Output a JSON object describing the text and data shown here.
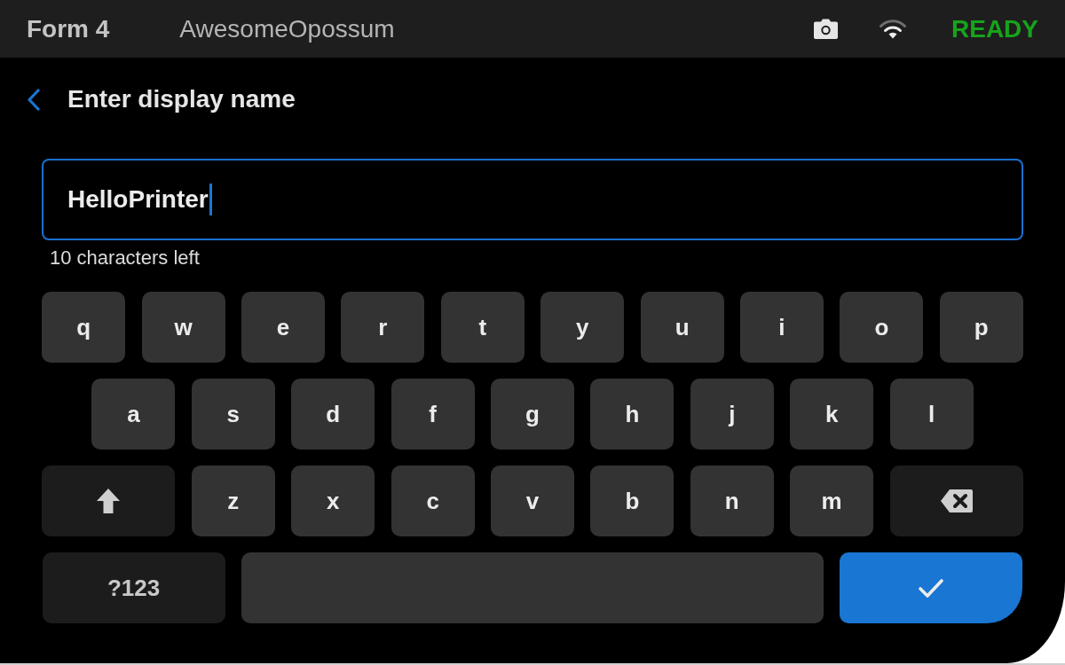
{
  "status_bar": {
    "model": "Form 4",
    "printer_name": "AwesomeOpossum",
    "status": "READY"
  },
  "header": {
    "title": "Enter display name"
  },
  "name_field": {
    "value": "HelloPrinter",
    "focused": true
  },
  "helper_text": "10 characters left",
  "keyboard": {
    "rows": [
      [
        {
          "kind": "letter",
          "label": "q"
        },
        {
          "kind": "letter",
          "label": "w"
        },
        {
          "kind": "letter",
          "label": "e"
        },
        {
          "kind": "letter",
          "label": "r"
        },
        {
          "kind": "letter",
          "label": "t"
        },
        {
          "kind": "letter",
          "label": "y"
        },
        {
          "kind": "letter",
          "label": "u"
        },
        {
          "kind": "letter",
          "label": "i"
        },
        {
          "kind": "letter",
          "label": "o"
        },
        {
          "kind": "letter",
          "label": "p"
        }
      ],
      [
        {
          "kind": "letter",
          "label": "a"
        },
        {
          "kind": "letter",
          "label": "s"
        },
        {
          "kind": "letter",
          "label": "d"
        },
        {
          "kind": "letter",
          "label": "f"
        },
        {
          "kind": "letter",
          "label": "g"
        },
        {
          "kind": "letter",
          "label": "h"
        },
        {
          "kind": "letter",
          "label": "j"
        },
        {
          "kind": "letter",
          "label": "k"
        },
        {
          "kind": "letter",
          "label": "l"
        }
      ],
      [
        {
          "kind": "shift"
        },
        {
          "kind": "letter",
          "label": "z"
        },
        {
          "kind": "letter",
          "label": "x"
        },
        {
          "kind": "letter",
          "label": "c"
        },
        {
          "kind": "letter",
          "label": "v"
        },
        {
          "kind": "letter",
          "label": "b"
        },
        {
          "kind": "letter",
          "label": "n"
        },
        {
          "kind": "letter",
          "label": "m"
        },
        {
          "kind": "backspace"
        }
      ],
      [
        {
          "kind": "symbols",
          "label": "?123"
        },
        {
          "kind": "space"
        },
        {
          "kind": "enter"
        }
      ]
    ]
  }
}
